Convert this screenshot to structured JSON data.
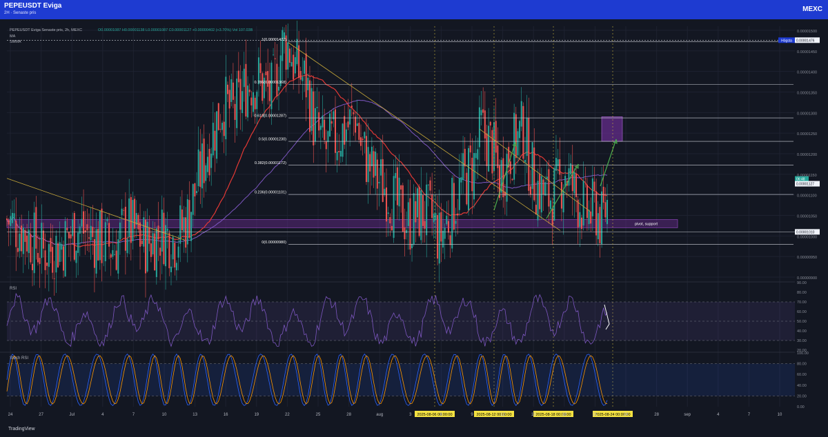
{
  "header": {
    "title": "PEPEUSDT Eviga",
    "subtitle": "2H  ·  Senaste pris",
    "brand": "MEXC"
  },
  "legend": {
    "line1": "PEPEUSDT Eviga Senaste pris, 2h, MEXC",
    "ohlc": "O0.00001087  H0.00001138  L0.00001087  C0.00001127  +0.00000402 (+3.70%)  Vol 107.03B",
    "line2": "MA",
    "line3": "SMMA"
  },
  "footer": {
    "brand": "TradingView"
  },
  "colors": {
    "background": "#131722",
    "header": "#1e3bd1",
    "up": "#26a69a",
    "down": "#ef5350",
    "ma": "#e53935",
    "smma": "#7e57c2",
    "fib": "#d1d4dc",
    "trend": "#c8a93a",
    "arrow": "#4caf50",
    "rsi": "#7e57c2",
    "stoch_k": "#2962ff",
    "stoch_d": "#ff9800",
    "zone": "#6a2d91",
    "date_label": "#f4e242"
  },
  "price_labels": {
    "high_tag": "Högsta",
    "high_value": "0.00001476",
    "last_value": "0.00001127",
    "countdown": "06:48",
    "low_value": "0.00001010"
  },
  "annotations": {
    "support_zone": "pivot, support",
    "fib_levels": [
      {
        "label": "1(0.00001472)",
        "value": 1.472e-05
      },
      {
        "label": "0.786(0.00001368)",
        "value": 1.368e-05
      },
      {
        "label": "0.618(0.00001287)",
        "value": 1.287e-05
      },
      {
        "label": "0.5(0.00001230)",
        "value": 1.23e-05
      },
      {
        "label": "0.382(0.00001172)",
        "value": 1.172e-05
      },
      {
        "label": "0.236(0.00001101)",
        "value": 1.101e-05
      },
      {
        "label": "0(0.00000980)",
        "value": 9.8e-06
      }
    ],
    "vertical_dates": [
      "2025-08-06   00:00:00",
      "2025-08-12   00:00:00",
      "2025-08-18   00:00:00",
      "2025-08-24   00:00:00"
    ]
  },
  "panes": {
    "rsi_label": "RSI",
    "stoch_label": "Stoch RSI"
  },
  "chart_data": {
    "type": "candlestick",
    "title": "PEPEUSDT Eviga Senaste pris, 2h, MEXC",
    "x_ticks": [
      "24",
      "27",
      "Jul",
      "4",
      "7",
      "10",
      "13",
      "16",
      "19",
      "22",
      "25",
      "28",
      "aug",
      "3",
      "6",
      "9",
      "12",
      "15",
      "18",
      "21",
      "24",
      "28",
      "sep",
      "4",
      "7",
      "10"
    ],
    "y_ticks": [
      "0.00001500",
      "0.00001450",
      "0.00001400",
      "0.00001350",
      "0.00001300",
      "0.00001250",
      "0.00001200",
      "0.00001150",
      "0.00001100",
      "0.00001050",
      "0.00001000",
      "0.00000950",
      "0.00000900"
    ],
    "ylim": [
      8.9e-06,
      1.51e-05
    ],
    "close_path": [
      [
        0,
        1.04e-05
      ],
      [
        3,
        1.01e-05
      ],
      [
        6,
        9.6e-06
      ],
      [
        9,
        9.8e-06
      ],
      [
        12,
        1.02e-05
      ],
      [
        15,
        9.9e-06
      ],
      [
        18,
        9.7e-06
      ],
      [
        20,
        1.03e-05
      ],
      [
        23,
        9.8e-06
      ],
      [
        26,
        1.01e-05
      ],
      [
        28,
        9.9e-06
      ],
      [
        30,
        1.04e-05
      ],
      [
        32,
        1.14e-05
      ],
      [
        34,
        1.24e-05
      ],
      [
        36,
        1.32e-05
      ],
      [
        38,
        1.3e-05
      ],
      [
        40,
        1.37e-05
      ],
      [
        42,
        1.38e-05
      ],
      [
        44,
        1.34e-05
      ],
      [
        46,
        1.47e-05
      ],
      [
        47,
        1.46e-05
      ],
      [
        48,
        1.41e-05
      ],
      [
        50,
        1.37e-05
      ],
      [
        51,
        1.28e-05
      ],
      [
        53,
        1.21e-05
      ],
      [
        55,
        1.24e-05
      ],
      [
        57,
        1.27e-05
      ],
      [
        58,
        1.3e-05
      ],
      [
        59,
        1.22e-05
      ],
      [
        61,
        1.15e-05
      ],
      [
        63,
        1.12e-05
      ],
      [
        65,
        1.07e-05
      ],
      [
        67,
        1.03e-05
      ],
      [
        69,
        1.06e-05
      ],
      [
        71,
        1.04e-05
      ],
      [
        72,
        9.9e-06
      ],
      [
        74,
        1.06e-05
      ],
      [
        76,
        1.13e-05
      ],
      [
        78,
        1.18e-05
      ],
      [
        79,
        1.26e-05
      ],
      [
        81,
        1.21e-05
      ],
      [
        82,
        1.14e-05
      ],
      [
        84,
        1.21e-05
      ],
      [
        86,
        1.26e-05
      ],
      [
        87,
        1.18e-05
      ],
      [
        88,
        1.13e-05
      ],
      [
        90,
        1.09e-05
      ],
      [
        92,
        1.12e-05
      ],
      [
        93,
        1.16e-05
      ],
      [
        95,
        1.09e-05
      ],
      [
        97,
        1.05e-05
      ],
      [
        98,
        1.07e-05
      ],
      [
        99,
        1.03e-05
      ],
      [
        100,
        1.08e-05
      ]
    ],
    "rsi_range": [
      20,
      90
    ],
    "rsi_bands": [
      30,
      50,
      70
    ],
    "stoch_range": [
      0,
      100
    ],
    "stoch_bands": [
      20,
      80
    ],
    "grid": true
  }
}
